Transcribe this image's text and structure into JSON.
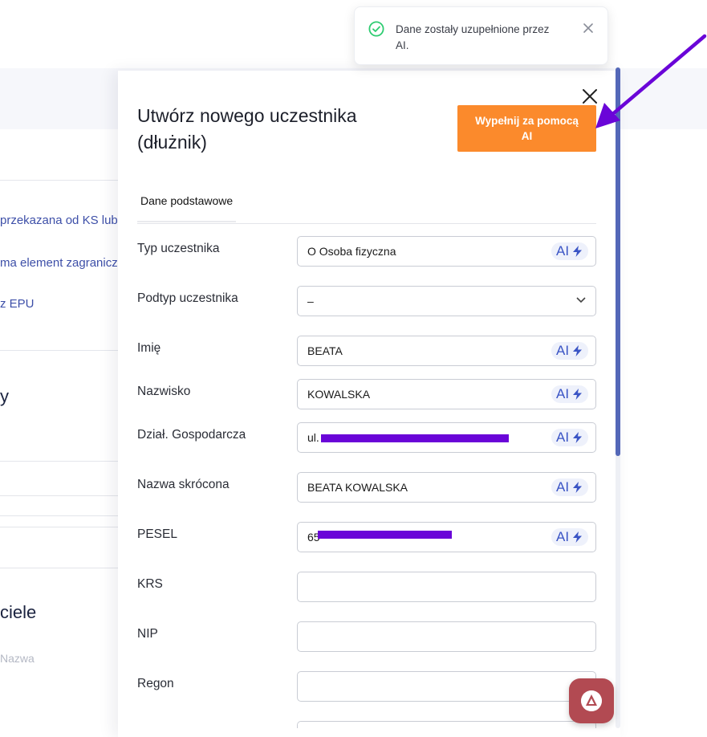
{
  "toast": {
    "message": "Dane zostały uzupełnione przez AI.",
    "icon": "check-circle-icon"
  },
  "background": {
    "link1": "przekazana od KS lub",
    "link2": "ma element zagranicz",
    "link3": "z EPU",
    "heading1": "y",
    "heading2": "ciele",
    "muted1": "Nazwa"
  },
  "panel": {
    "title": "Utwórz nowego uczestnika (dłużnik)",
    "ai_fill_button": "Wypełnij za pomocą AI",
    "tab_basic": "Dane podstawowe",
    "ai_badge": "AI"
  },
  "fields": {
    "participant_type": {
      "label": "Typ uczestnika",
      "value": "O Osoba fizyczna"
    },
    "participant_subtype": {
      "label": "Podtyp uczestnika",
      "value": "–"
    },
    "first_name": {
      "label": "Imię",
      "value": "BEATA"
    },
    "last_name": {
      "label": "Nazwisko",
      "value": "KOWALSKA"
    },
    "business": {
      "label": "Dział. Gospodarcza",
      "value": "ul."
    },
    "short_name": {
      "label": "Nazwa skrócona",
      "value": "BEATA KOWALSKA"
    },
    "pesel": {
      "label": "PESEL",
      "value": "65"
    },
    "krs": {
      "label": "KRS",
      "value": ""
    },
    "nip": {
      "label": "NIP",
      "value": ""
    },
    "regon": {
      "label": "Regon",
      "value": ""
    }
  },
  "colors": {
    "accent_orange": "#fb8a2c",
    "ai_blue": "#3b55c5",
    "redaction_purple": "#6a05d8",
    "annotation_arrow": "#6a05d8",
    "success_green": "#2ecc71"
  }
}
